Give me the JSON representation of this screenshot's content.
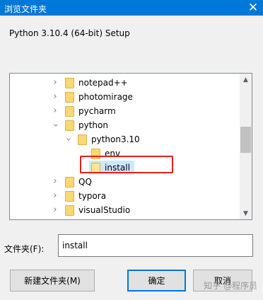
{
  "window": {
    "title": "浏览文件夹",
    "close_glyph": "✕"
  },
  "description": "Python 3.10.4 (64-bit) Setup",
  "tree": {
    "items": [
      {
        "label": "notepad++",
        "expander": "collapsed"
      },
      {
        "label": "photomirage",
        "expander": "collapsed"
      },
      {
        "label": "pycharm",
        "expander": "collapsed"
      },
      {
        "label": "python",
        "expander": "expanded"
      },
      {
        "label": "python3.10",
        "expander": "expanded"
      },
      {
        "label": "env",
        "expander": "none"
      },
      {
        "label": "install",
        "expander": "none",
        "selected": true
      },
      {
        "label": "QQ",
        "expander": "collapsed"
      },
      {
        "label": "typora",
        "expander": "collapsed"
      },
      {
        "label": "visualStudio",
        "expander": "collapsed"
      }
    ]
  },
  "folder_field": {
    "label": "文件夹(F):",
    "value": "install"
  },
  "buttons": {
    "new_folder": "新建文件夹(M)",
    "ok": "确定",
    "cancel": "取消"
  },
  "watermark": "知乎 @程序员",
  "colors": {
    "titlebar": "#0078d7",
    "selection": "#cce8ff",
    "highlight_box": "#e02020",
    "folder": "#f8d775"
  }
}
